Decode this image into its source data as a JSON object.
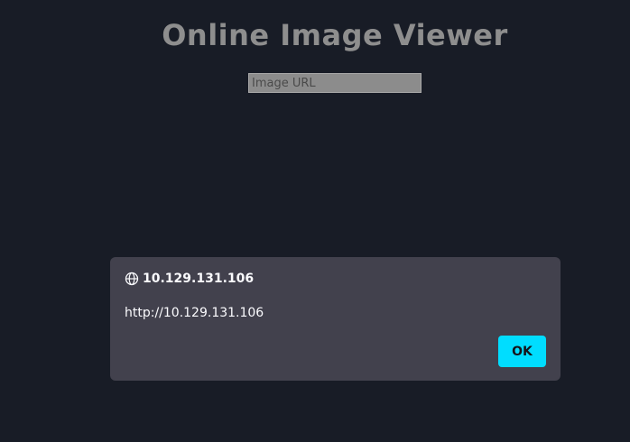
{
  "page": {
    "title": "Online Image Viewer",
    "url_input": {
      "placeholder": "Image URL",
      "value": ""
    }
  },
  "dialog": {
    "icon": "globe-icon",
    "title": "10.129.131.106",
    "message": "http://10.129.131.106",
    "ok_label": "OK"
  },
  "colors": {
    "background": "#181c26",
    "title": "#8e8e8e",
    "input_background": "#8c8c8c",
    "dialog_background": "#42414d",
    "accent": "#00ddff"
  }
}
